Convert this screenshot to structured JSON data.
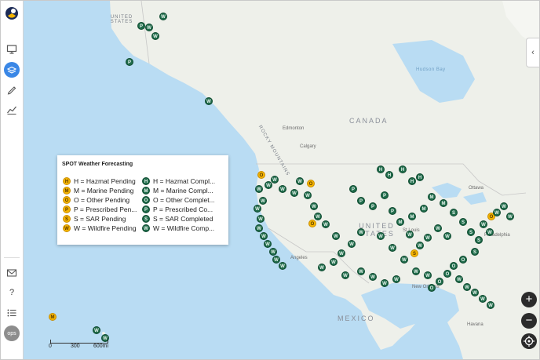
{
  "sidebar": {
    "items": [
      {
        "name": "monitor-icon"
      },
      {
        "name": "layers-icon"
      },
      {
        "name": "pencil-icon"
      },
      {
        "name": "chart-icon"
      },
      {
        "name": "mail-icon"
      },
      {
        "name": "help-icon",
        "label": "?"
      },
      {
        "name": "list-icon"
      }
    ],
    "avatar": "ops"
  },
  "legend": {
    "title": "SPOT Weather Forecasting",
    "pending": [
      {
        "code": "H",
        "label": "H = Hazmat Pending"
      },
      {
        "code": "M",
        "label": "M = Marine Pending"
      },
      {
        "code": "O",
        "label": "O = Other Pending"
      },
      {
        "code": "P",
        "label": "P = Prescribed Pen..."
      },
      {
        "code": "S",
        "label": "S = SAR Pending"
      },
      {
        "code": "W",
        "label": "W = Wildfire Pending"
      }
    ],
    "completed": [
      {
        "code": "H",
        "label": "H = Hazmat Compl..."
      },
      {
        "code": "M",
        "label": "M = Marine Compl..."
      },
      {
        "code": "O",
        "label": "O = Other Complet..."
      },
      {
        "code": "P",
        "label": "P = Prescribed Co..."
      },
      {
        "code": "S",
        "label": "S = SAR Completed"
      },
      {
        "code": "W",
        "label": "W = Wildfire Comp..."
      }
    ]
  },
  "map_labels": {
    "canada": "CANADA",
    "united_states": "UNITED STATES",
    "alaska_top": "UNITED STATES",
    "mexico": "MEXICO",
    "rocky": "ROCKY MOUNTAINS",
    "hudson_bay": "Hudson Bay",
    "edmonton": "Edmonton",
    "calgary": "Calgary",
    "ottawa": "Ottawa",
    "st_louis": "St Louis",
    "philadelphia": "Philadelphia",
    "angeles": "Angeles",
    "new_orleans": "New Orleans",
    "havana": "Havana"
  },
  "controls": {
    "zoom_in": "+",
    "zoom_out": "−",
    "collapse": "‹"
  },
  "scale": {
    "zero": "0",
    "mid": "300",
    "end": "600mi"
  },
  "colors": {
    "completed": "#1f6b4a",
    "pending": "#f4b400",
    "water": "#b9dcf3",
    "land": "#eef0ea"
  },
  "markers": [
    {
      "code": "P",
      "status": "completed"
    },
    {
      "code": "W",
      "status": "completed"
    },
    {
      "code": "W",
      "status": "completed"
    },
    {
      "code": "W",
      "status": "completed"
    },
    {
      "code": "P",
      "status": "completed"
    },
    {
      "code": "W",
      "status": "completed"
    },
    {
      "code": "M",
      "status": "pending"
    },
    {
      "code": "W",
      "status": "completed"
    },
    {
      "code": "W",
      "status": "completed"
    },
    {
      "code": "O",
      "status": "pending"
    },
    {
      "code": "O",
      "status": "pending"
    },
    {
      "code": "O",
      "status": "pending"
    },
    {
      "code": "S",
      "status": "pending"
    },
    {
      "code": "O",
      "status": "pending"
    },
    {
      "code": "W",
      "status": "completed"
    },
    {
      "code": "W",
      "status": "completed"
    },
    {
      "code": "W",
      "status": "completed"
    },
    {
      "code": "W",
      "status": "completed"
    },
    {
      "code": "W",
      "status": "completed"
    },
    {
      "code": "W",
      "status": "completed"
    },
    {
      "code": "W",
      "status": "completed"
    },
    {
      "code": "W",
      "status": "completed"
    },
    {
      "code": "W",
      "status": "completed"
    },
    {
      "code": "W",
      "status": "completed"
    },
    {
      "code": "W",
      "status": "completed"
    },
    {
      "code": "W",
      "status": "completed"
    },
    {
      "code": "W",
      "status": "completed"
    },
    {
      "code": "W",
      "status": "completed"
    },
    {
      "code": "W",
      "status": "completed"
    },
    {
      "code": "W",
      "status": "completed"
    },
    {
      "code": "W",
      "status": "completed"
    },
    {
      "code": "W",
      "status": "completed"
    },
    {
      "code": "W",
      "status": "completed"
    },
    {
      "code": "W",
      "status": "completed"
    },
    {
      "code": "H",
      "status": "completed"
    },
    {
      "code": "H",
      "status": "completed"
    },
    {
      "code": "H",
      "status": "completed"
    },
    {
      "code": "H",
      "status": "completed"
    },
    {
      "code": "H",
      "status": "completed"
    },
    {
      "code": "P",
      "status": "completed"
    },
    {
      "code": "P",
      "status": "completed"
    },
    {
      "code": "P",
      "status": "completed"
    },
    {
      "code": "P",
      "status": "completed"
    },
    {
      "code": "P",
      "status": "completed"
    },
    {
      "code": "M",
      "status": "completed"
    },
    {
      "code": "M",
      "status": "completed"
    },
    {
      "code": "M",
      "status": "completed"
    },
    {
      "code": "M",
      "status": "completed"
    },
    {
      "code": "M",
      "status": "completed"
    },
    {
      "code": "S",
      "status": "completed"
    },
    {
      "code": "S",
      "status": "completed"
    },
    {
      "code": "S",
      "status": "completed"
    },
    {
      "code": "S",
      "status": "completed"
    },
    {
      "code": "S",
      "status": "completed"
    },
    {
      "code": "O",
      "status": "completed"
    },
    {
      "code": "O",
      "status": "completed"
    },
    {
      "code": "O",
      "status": "completed"
    },
    {
      "code": "O",
      "status": "completed"
    },
    {
      "code": "O",
      "status": "completed"
    },
    {
      "code": "W",
      "status": "completed"
    },
    {
      "code": "W",
      "status": "completed"
    },
    {
      "code": "W",
      "status": "completed"
    },
    {
      "code": "W",
      "status": "completed"
    },
    {
      "code": "W",
      "status": "completed"
    },
    {
      "code": "W",
      "status": "completed"
    },
    {
      "code": "W",
      "status": "completed"
    },
    {
      "code": "W",
      "status": "completed"
    },
    {
      "code": "W",
      "status": "completed"
    },
    {
      "code": "W",
      "status": "completed"
    },
    {
      "code": "W",
      "status": "completed"
    },
    {
      "code": "W",
      "status": "completed"
    },
    {
      "code": "W",
      "status": "completed"
    },
    {
      "code": "W",
      "status": "completed"
    },
    {
      "code": "W",
      "status": "completed"
    },
    {
      "code": "W",
      "status": "completed"
    },
    {
      "code": "W",
      "status": "completed"
    },
    {
      "code": "W",
      "status": "completed"
    },
    {
      "code": "W",
      "status": "completed"
    },
    {
      "code": "W",
      "status": "completed"
    },
    {
      "code": "W",
      "status": "completed"
    },
    {
      "code": "W",
      "status": "completed"
    },
    {
      "code": "W",
      "status": "completed"
    },
    {
      "code": "W",
      "status": "completed"
    },
    {
      "code": "W",
      "status": "completed"
    },
    {
      "code": "W",
      "status": "completed"
    },
    {
      "code": "W",
      "status": "completed"
    },
    {
      "code": "W",
      "status": "completed"
    },
    {
      "code": "W",
      "status": "completed"
    },
    {
      "code": "W",
      "status": "completed"
    },
    {
      "code": "W",
      "status": "completed"
    },
    {
      "code": "W",
      "status": "completed"
    },
    {
      "code": "W",
      "status": "completed"
    },
    {
      "code": "W",
      "status": "completed"
    },
    {
      "code": "W",
      "status": "completed"
    }
  ]
}
